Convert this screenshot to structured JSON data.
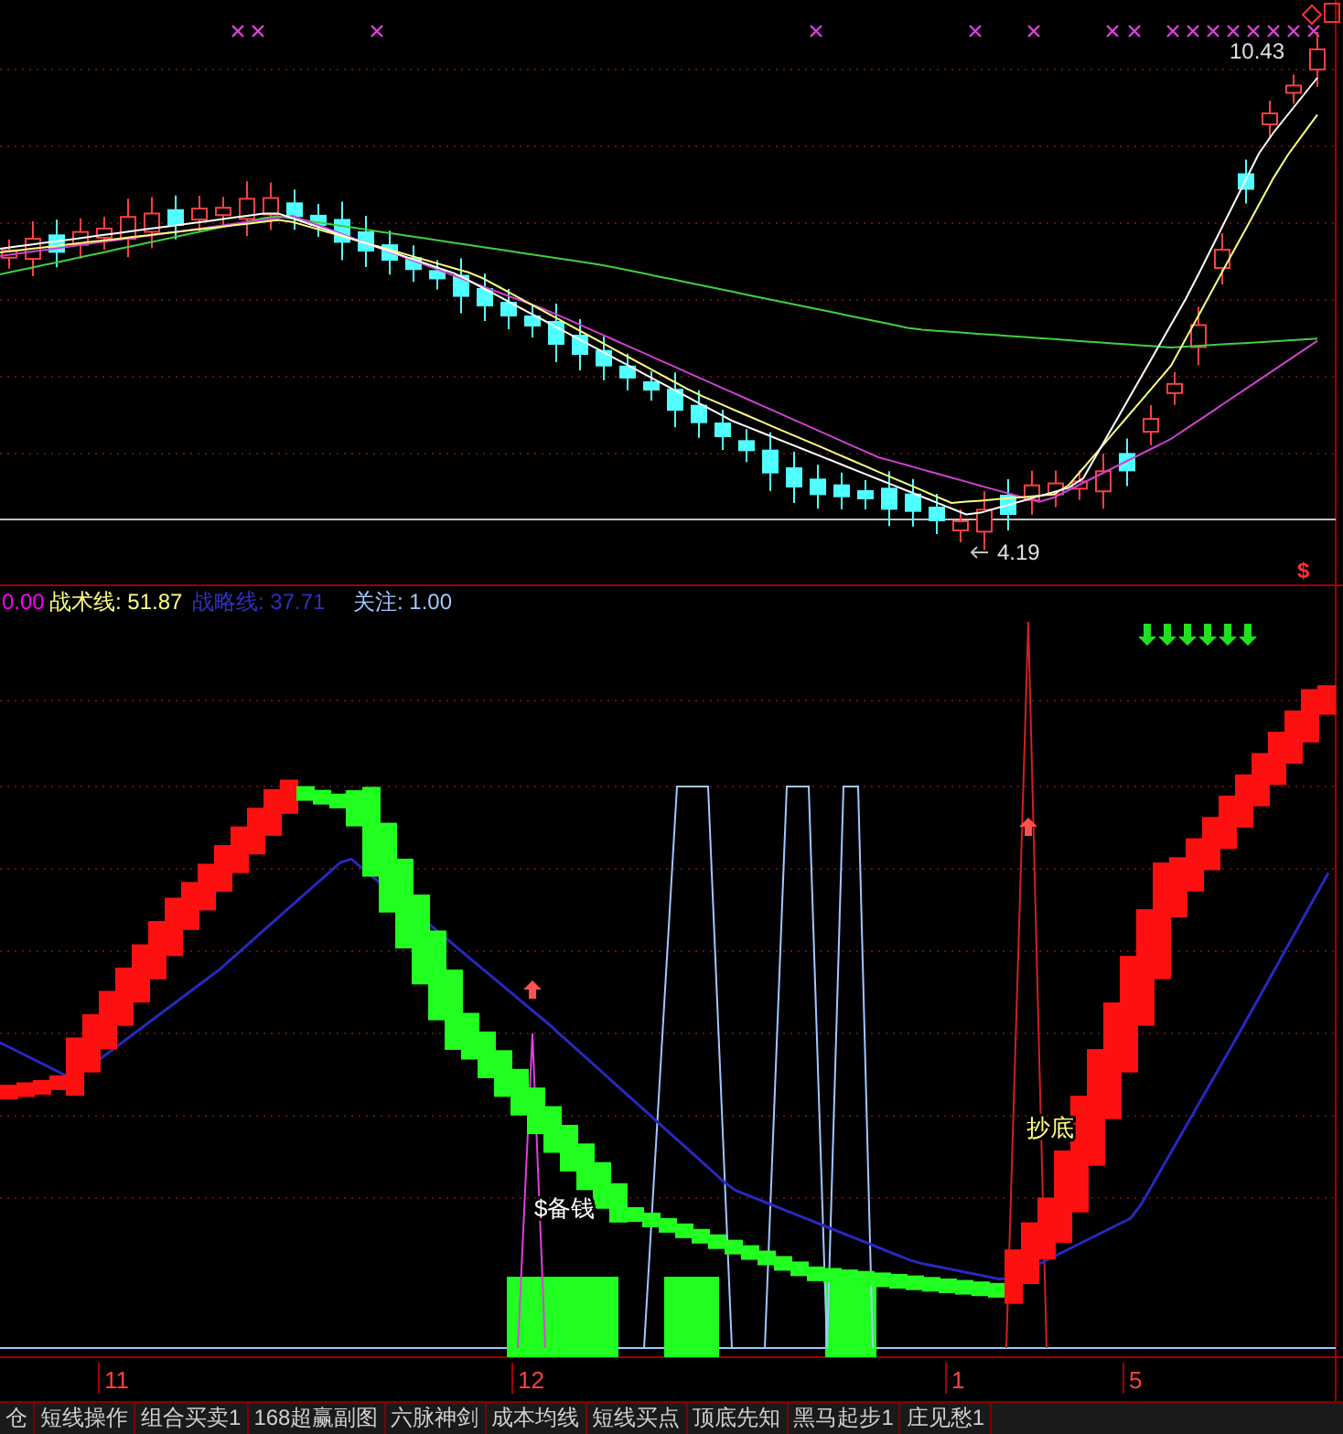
{
  "price_panel": {
    "high_label": "10.43",
    "low_label": "4.19",
    "signal_mark": "$"
  },
  "indicator_panel": {
    "legend": [
      {
        "text": "0.00",
        "color": "#ff00ff"
      },
      {
        "text": "战术线: 51.87",
        "color": "#ffff80"
      },
      {
        "text": "战略线: 37.71",
        "color": "#3030c0"
      },
      {
        "text": "关注: 1.00",
        "color": "#a0c8ff"
      }
    ],
    "labels": [
      {
        "kind": "buy",
        "text": "抄底"
      },
      {
        "kind": "save",
        "text": "$备钱"
      }
    ]
  },
  "x_axis": [
    "11",
    "12",
    "1",
    "5"
  ],
  "tabs": [
    {
      "label": "仓",
      "selected": false
    },
    {
      "label": "短线操作",
      "selected": false
    },
    {
      "label": "组合买卖1",
      "selected": false
    },
    {
      "label": "168超赢副图",
      "selected": false
    },
    {
      "label": "六脉神剑",
      "selected": false
    },
    {
      "label": "成本均线",
      "selected": false
    },
    {
      "label": "短线买点",
      "selected": false
    },
    {
      "label": "顶底先知",
      "selected": false
    },
    {
      "label": "黑马起步1",
      "selected": false
    },
    {
      "label": "庄见愁1",
      "selected": false
    }
  ]
}
